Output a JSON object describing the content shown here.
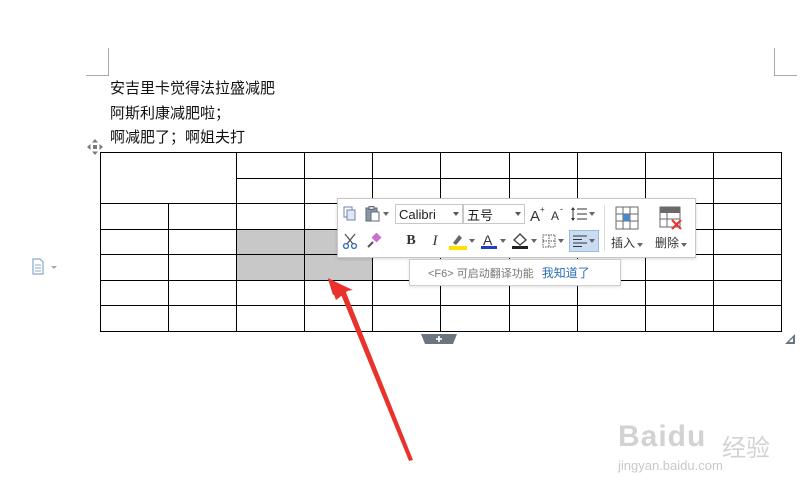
{
  "document": {
    "paragraphs": [
      "安吉里卡觉得法拉盛减肥",
      "阿斯利康减肥啦；",
      "啊减肥了；啊姐夫打"
    ]
  },
  "table": {
    "rows": 7,
    "cols": 10,
    "selected_cells": [
      [
        3,
        2
      ],
      [
        3,
        3
      ],
      [
        4,
        2
      ],
      [
        4,
        3
      ]
    ]
  },
  "toolbar": {
    "font_name": "Calibri",
    "font_size": "五号",
    "bold_label": "B",
    "italic_label": "I",
    "insert_label": "插入",
    "delete_label": "删除",
    "highlight_color": "#ffe000",
    "font_color": "#1f3fbf"
  },
  "tip": {
    "text": "<F6> 可启动翻译功能",
    "link": "我知道了"
  },
  "annotation": {
    "arrow_color": "#e8322b"
  },
  "watermark": {
    "brand": "Baidu",
    "brand_cn": "经验",
    "url": "jingyan.baidu.com"
  }
}
